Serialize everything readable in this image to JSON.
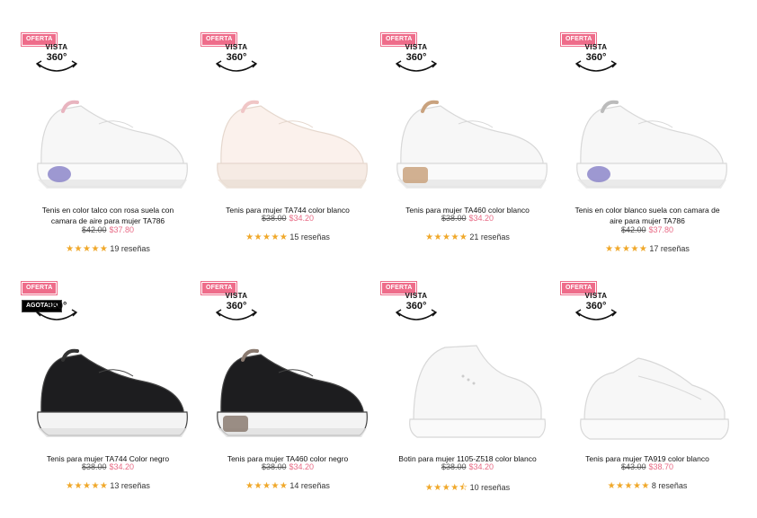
{
  "products": [
    {
      "badge": "OFERTA",
      "view360": {
        "top": "VISTA",
        "bottom": "360°"
      },
      "name": "Tenis en color talco con rosa suela con camara de aire para mujer TA786",
      "old_price": "$42.00",
      "new_price": "$37.80",
      "stars": "★★★★★",
      "reviews": "19 reseñas",
      "rating_value": 5,
      "color": "white",
      "accent": "#e8b4bf",
      "airbubble": true
    },
    {
      "badge": "OFERTA",
      "view360": {
        "top": "VISTA",
        "bottom": "360°"
      },
      "name": "Tenis para mujer TA744 color blanco",
      "old_price": "$38.00",
      "new_price": "$34.20",
      "stars": "★★★★★",
      "reviews": "15 reseñas",
      "rating_value": 5,
      "color": "cream",
      "accent": "#f0c6c6",
      "airbubble": false
    },
    {
      "badge": "OFERTA",
      "view360": {
        "top": "VISTA",
        "bottom": "360°"
      },
      "name": "Tenis para mujer TA460 color blanco",
      "old_price": "$38.00",
      "new_price": "$34.20",
      "stars": "★★★★★",
      "reviews": "21 reseñas",
      "rating_value": 5,
      "color": "white",
      "accent": "#c9a27e",
      "airbubble": false
    },
    {
      "badge": "OFERTA",
      "view360": {
        "top": "VISTA",
        "bottom": "360°"
      },
      "name": "Tenis en color blanco suela con camara de aire para mujer TA786",
      "old_price": "$42.00",
      "new_price": "$37.80",
      "stars": "★★★★★",
      "reviews": "17 reseñas",
      "rating_value": 5,
      "color": "white",
      "accent": "#bbbbbb",
      "airbubble": true
    },
    {
      "badge": "OFERTA",
      "sold_out": "AGOTADO",
      "view360": {
        "top": "",
        "bottom": "360°"
      },
      "name": "Tenis para mujer TA744 Color negro",
      "old_price": "$38.00",
      "new_price": "$34.20",
      "stars": "★★★★★",
      "reviews": "13 reseñas",
      "rating_value": 5,
      "color": "black",
      "accent": "#333333",
      "airbubble": false
    },
    {
      "badge": "OFERTA",
      "view360": {
        "top": "VISTA",
        "bottom": "360°"
      },
      "name": "Tenis para mujer TA460 color negro",
      "old_price": "$38.00",
      "new_price": "$34.20",
      "stars": "★★★★★",
      "reviews": "14 reseñas",
      "rating_value": 5,
      "color": "black",
      "accent": "#8a7a70",
      "airbubble": false
    },
    {
      "badge": "OFERTA",
      "view360": {
        "top": "VISTA",
        "bottom": "360°"
      },
      "name": "Botin para mujer 1105-Z518 color blanco",
      "old_price": "$38.00",
      "new_price": "$34.20",
      "stars": "★★★★⯪",
      "reviews": "10 reseñas",
      "rating_value": 4.5,
      "color": "hightop",
      "accent": "#dddddd",
      "airbubble": false
    },
    {
      "badge": "OFERTA",
      "view360": {
        "top": "VISTA",
        "bottom": "360°"
      },
      "name": "Tenis para mujer TA919 color blanco",
      "old_price": "$43.00",
      "new_price": "$38.70",
      "stars": "★★★★★",
      "reviews": "8 reseñas",
      "rating_value": 5,
      "color": "court",
      "accent": "#dddddd",
      "airbubble": false
    }
  ]
}
